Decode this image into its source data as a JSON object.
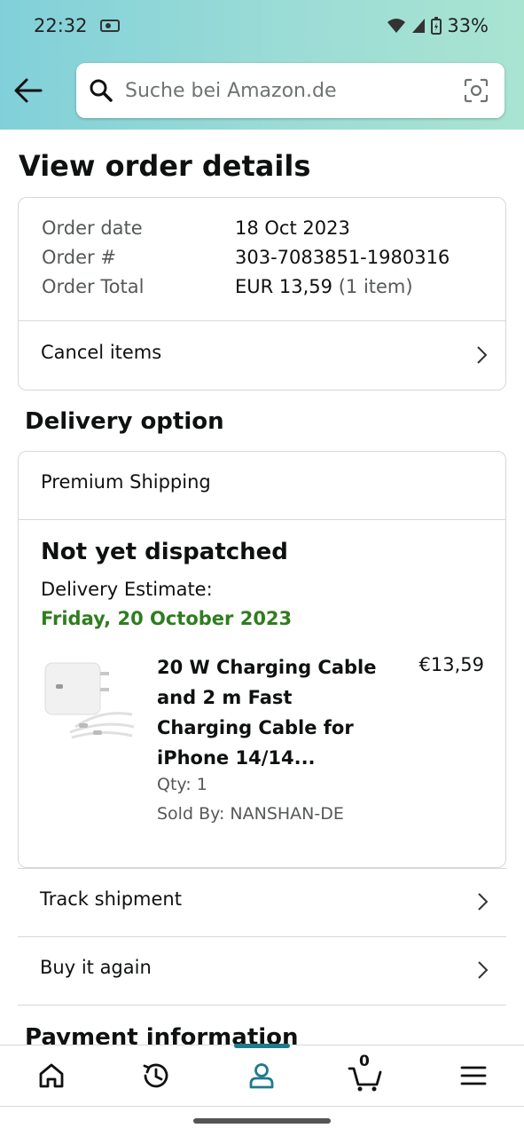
{
  "status_bar": {
    "time": "22:32",
    "battery": "33%"
  },
  "search": {
    "placeholder": "Suche bei Amazon.de"
  },
  "page_title": "View order details",
  "order_summary": {
    "date_label": "Order date",
    "date_value": "18 Oct 2023",
    "number_label": "Order #",
    "number_value": "303-7083851-1980316",
    "total_label": "Order Total",
    "total_value": "EUR 13,59",
    "total_items": "(1 item)",
    "cancel_label": "Cancel items"
  },
  "delivery": {
    "section_title": "Delivery option",
    "shipping_method": "Premium Shipping",
    "status": "Not yet dispatched",
    "estimate_label": "Delivery Estimate:",
    "estimate_date": "Friday, 20 October 2023",
    "estimate_color": "#2f7d1f",
    "product": {
      "title": "20 W Charging Cable and 2 m Fast Charging Cable for iPhone 14/14...",
      "price": "€13,59",
      "qty": "Qty: 1",
      "seller": "Sold By: NANSHAN-DE"
    }
  },
  "actions": {
    "track": "Track shipment",
    "buy_again": "Buy it again"
  },
  "payment_title": "Payment information",
  "bottom_nav": {
    "items": [
      "home-icon",
      "history-icon",
      "account-icon",
      "cart-icon",
      "menu-icon"
    ],
    "cart_count": "0",
    "accent": "#1e7a8c"
  }
}
